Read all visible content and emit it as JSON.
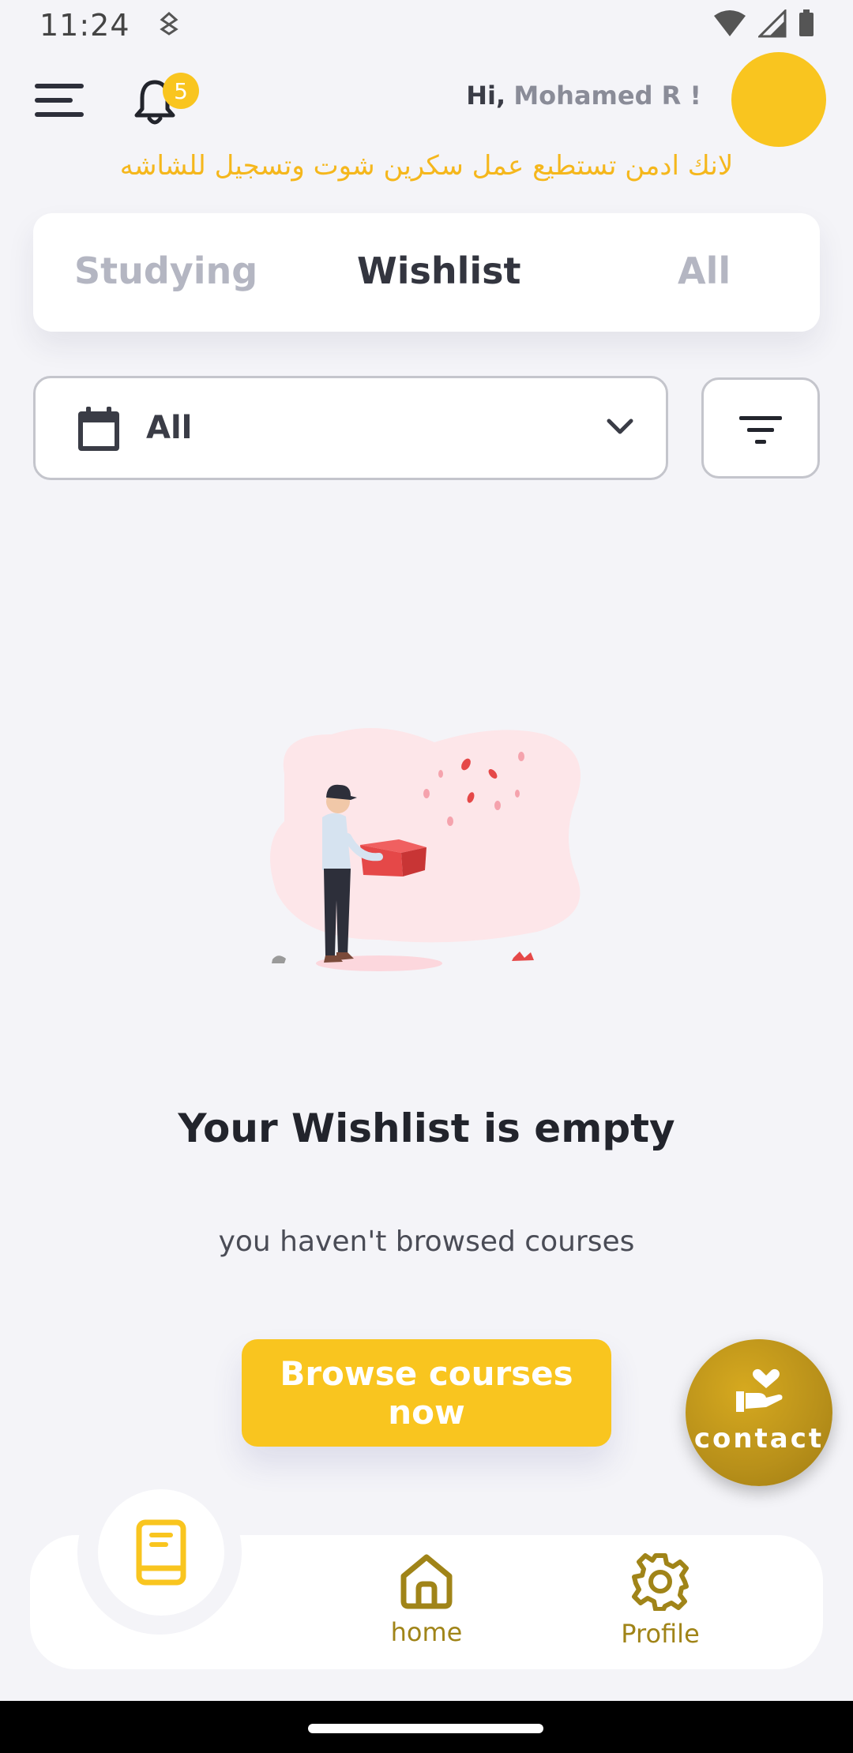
{
  "status_bar": {
    "time": "11:24"
  },
  "header": {
    "notification_count": "5",
    "greeting_hi": "Hi,",
    "greeting_name": "Mohamed R !",
    "notice": "لانك ادمن تستطيع عمل سكرين شوت وتسجيل للشاشه"
  },
  "tabs": {
    "studying": "Studying",
    "wishlist": "Wishlist",
    "all": "All",
    "active": "Wishlist"
  },
  "filter": {
    "date_value": "All"
  },
  "empty_state": {
    "title": "Your Wishlist is empty",
    "subtitle": "you haven't browsed courses",
    "button_label": "Browse courses now"
  },
  "contact": {
    "label": "contact"
  },
  "bottom_nav": {
    "home_label": "home",
    "profile_label": "Profile",
    "active_item": "my-courses"
  },
  "colors": {
    "accent": "#f9c51f",
    "nav_text": "#a08418",
    "contact_fab": "#b8901a",
    "background": "#f4f4f8"
  }
}
